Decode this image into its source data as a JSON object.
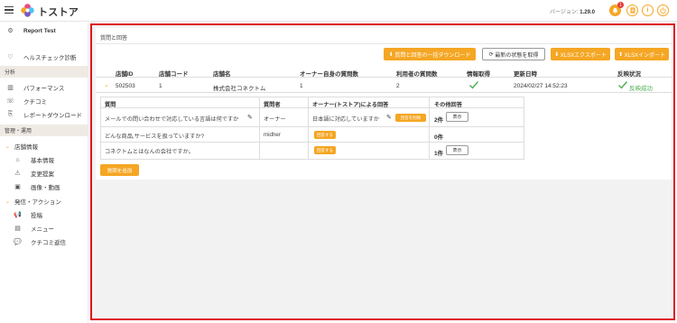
{
  "header": {
    "brand": "トストア",
    "version_label": "バージョン:",
    "version_value": "1.29.0",
    "notification_count": "1",
    "accent_color": "#f5a623"
  },
  "sidebar": {
    "account": "Report Test",
    "items": [
      {
        "label": "ヘルスチェック診断",
        "icon": "heart-icon"
      },
      {
        "label": "パフォーマンス",
        "icon": "chart-icon"
      },
      {
        "label": "クチコミ",
        "icon": "chat-icon"
      },
      {
        "label": "レポートダウンロード",
        "icon": "download-icon"
      },
      {
        "label": "基本情報",
        "icon": "store-icon"
      },
      {
        "label": "変更提案",
        "icon": "warning-icon"
      },
      {
        "label": "画像・動画",
        "icon": "image-icon"
      },
      {
        "label": "投稿",
        "icon": "megaphone-icon"
      },
      {
        "label": "メニュー",
        "icon": "menu-icon"
      },
      {
        "label": "クチコミ返信",
        "icon": "reply-icon"
      }
    ],
    "sections": {
      "analysis": "分析",
      "management": "管理・運用"
    },
    "groups": {
      "store_info": "店舗情報",
      "send_action": "発信・アクション"
    }
  },
  "main": {
    "breadcrumb": "質問と回答",
    "buttons": {
      "bulk_download": "質問と回答の一括ダウンロード",
      "refresh": "最新の状態を取得",
      "xlsx_export": "XLSXエクスポート",
      "xlsx_import": "XLSXインポート"
    },
    "columns": [
      "店舗ID",
      "店舗コード",
      "店舗名",
      "オーナー自身の質問数",
      "利用者の質問数",
      "情報取得",
      "更新日時",
      "反映状況"
    ],
    "row": {
      "store_id": "502503",
      "store_code": "1",
      "store_name": "株式会社コネクトム",
      "owner_questions": "1",
      "user_questions": "2",
      "updated_at": "2024/02/27 14:52:23",
      "status": "反映成功"
    },
    "sub_columns": [
      "質問",
      "質問者",
      "オーナー(トストア)による回答",
      "その他回答"
    ],
    "questions": [
      {
        "question": "メールでの問い合わせで対応している言語は何ですか",
        "asker": "オーナー",
        "answer": "日本語に対応していますか",
        "answer_button": "回答を削除",
        "other": "2件",
        "show": "表示"
      },
      {
        "question": "どんな商品,サービスを扱っていますか?",
        "asker": "midher",
        "answer": "",
        "answer_button": "回答する",
        "other": "0件",
        "show": ""
      },
      {
        "question": "コネクトムとはなんの会社ですか。",
        "asker": "",
        "answer": "",
        "answer_button": "回答する",
        "other": "1件",
        "show": "表示"
      }
    ],
    "add_question": "質問を追加"
  }
}
